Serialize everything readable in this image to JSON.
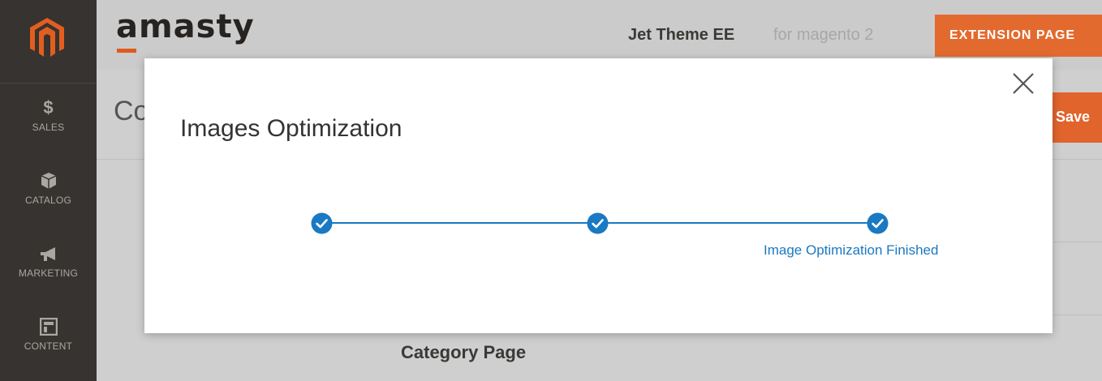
{
  "sidebar": {
    "items": [
      {
        "label": "SALES",
        "icon": "dollar-icon",
        "glyph": "$"
      },
      {
        "label": "CATALOG",
        "icon": "box-icon"
      },
      {
        "label": "MARKETING",
        "icon": "megaphone-icon"
      },
      {
        "label": "CONTENT",
        "icon": "layout-icon"
      }
    ]
  },
  "header": {
    "logo_text": "amasty",
    "theme_name": "Jet Theme EE",
    "theme_platform": "for magento 2",
    "extension_button": "EXTENSION PAGE"
  },
  "page": {
    "title_partial": "Co",
    "save_label": "Save",
    "category_label": "Category Page"
  },
  "modal": {
    "title": "Images Optimization",
    "steps": [
      {
        "status": "done"
      },
      {
        "status": "done"
      },
      {
        "status": "done",
        "label": "Image Optimization Finished"
      }
    ]
  },
  "colors": {
    "accent": "#1979c3",
    "brand_orange": "#e36a2f",
    "sidebar_bg": "#373330"
  }
}
